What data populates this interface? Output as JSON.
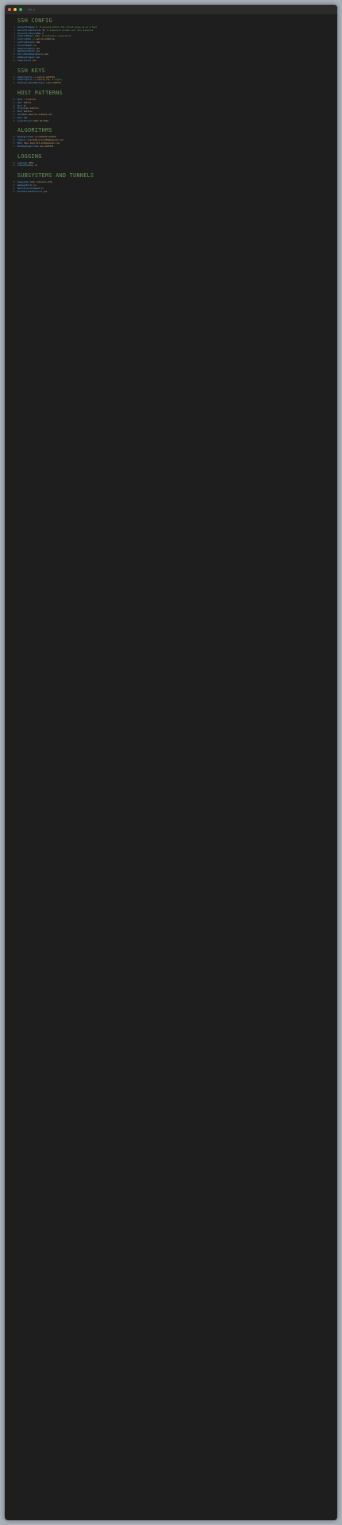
{
  "window": {
    "controls": [
      "close",
      "minimize",
      "maximize"
    ],
    "control_colors": [
      "#ff5f56",
      "#ffbd2e",
      "#27c93f"
    ],
    "file_label": "ssh.y"
  },
  "sections": [
    {
      "banner": "SSH CONFIG",
      "lines": [
        {
          "k": "ConnectTimeout",
          "v": "3",
          "c": "# seconds before the client gives up on a host"
        },
        {
          "k": "ServerAliveInterval",
          "v": "30",
          "c": "# keepalive probes over idle sessions"
        },
        {
          "k": "ServerAliveCountMax",
          "v": "4",
          "c": ""
        },
        {
          "k": "ControlMaster",
          "v": "auto",
          "c": "# multiplex connections"
        },
        {
          "k": "ControlPath",
          "v": "~/.ssh/cm-%r@%h:%p",
          "c": ""
        },
        {
          "k": "ControlPersist",
          "v": "10m",
          "c": ""
        },
        {
          "k": "ForwardAgent",
          "v": "no",
          "c": ""
        },
        {
          "k": "IdentitiesOnly",
          "v": "yes",
          "c": ""
        },
        {
          "k": "HashKnownHosts",
          "v": "yes",
          "c": ""
        },
        {
          "k": "StrictHostKeyChecking",
          "v": "ask",
          "c": ""
        },
        {
          "k": "AddKeysToAgent",
          "v": "yes",
          "c": ""
        },
        {
          "k": "Compression",
          "v": "yes",
          "c": ""
        }
      ]
    },
    {
      "banner": "SSH KEYS",
      "lines": [
        {
          "k": "IdentityFile",
          "v": "~/.ssh/id_ed25519",
          "c": ""
        },
        {
          "k": "IdentityFile",
          "v": "~/.ssh/id_rsa",
          "c": "# legacy"
        },
        {
          "k": "PubkeyAcceptedKeyTypes",
          "v": "+ssh-ed25519",
          "c": ""
        }
      ]
    },
    {
      "banner": "HOST PATTERNS",
      "lines": [
        {
          "k": "Host",
          "v": "*.internal",
          "c": ""
        },
        {
          "k": "User",
          "v": "deploy",
          "c": ""
        },
        {
          "k": "Port",
          "v": "22",
          "c": ""
        },
        {
          "k": "ProxyJump",
          "v": "bastion",
          "c": ""
        },
        {
          "k": "Host",
          "v": "bastion",
          "c": ""
        },
        {
          "k": "HostName",
          "v": "bastion.example.net",
          "c": ""
        },
        {
          "k": "User",
          "v": "ops",
          "c": ""
        },
        {
          "k": "LocalForward",
          "v": "5432 db:5432",
          "c": ""
        }
      ]
    },
    {
      "banner": "ALGORITHMS",
      "lines": [
        {
          "k": "KexAlgorithms",
          "v": "curve25519-sha256",
          "c": ""
        },
        {
          "k": "Ciphers",
          "v": "chacha20-poly1305@openssh.com",
          "c": ""
        },
        {
          "k": "MACs",
          "v": "hmac-sha2-512-etm@openssh.com",
          "c": ""
        },
        {
          "k": "HostKeyAlgorithms",
          "v": "ssh-ed25519",
          "c": ""
        }
      ]
    },
    {
      "banner": "LOGGING",
      "lines": [
        {
          "k": "LogLevel",
          "v": "INFO",
          "c": ""
        },
        {
          "k": "VisualHostKey",
          "v": "no",
          "c": ""
        }
      ]
    },
    {
      "banner": "SUBSYSTEMS AND TUNNELS",
      "lines": [
        {
          "k": "Subsystem",
          "v": "sftp internal-sftp",
          "c": ""
        },
        {
          "k": "GatewayPorts",
          "v": "no",
          "c": ""
        },
        {
          "k": "PermitLocalCommand",
          "v": "no",
          "c": ""
        },
        {
          "k": "ExitOnForwardFailure",
          "v": "yes",
          "c": ""
        }
      ]
    }
  ]
}
